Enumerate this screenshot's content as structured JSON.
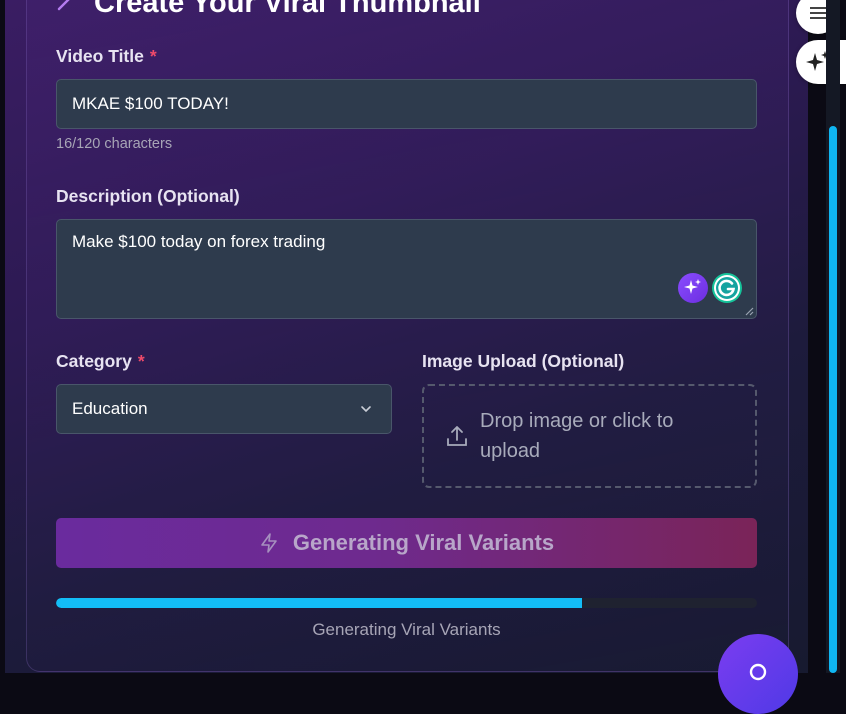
{
  "form": {
    "heading": "Create Your Viral Thumbnail",
    "title": {
      "label": "Video Title",
      "required": "*",
      "value": "MKAE $100 TODAY!",
      "counter": "16/120 characters"
    },
    "description": {
      "label": "Description (Optional)",
      "value": "Make $100 today on forex trading"
    },
    "category": {
      "label": "Category",
      "required": "*",
      "value": "Education"
    },
    "upload": {
      "label": "Image Upload (Optional)",
      "prompt": "Drop image or click to upload"
    },
    "generate_button": "Generating Viral Variants",
    "progress": {
      "percent": 75,
      "label": "Generating Viral Variants"
    }
  },
  "icons": {
    "heading": "magic-wand-icon",
    "upload": "upload-icon",
    "generate": "lightning-icon",
    "chevron": "chevron-down-icon",
    "ai_assist": "sparkles-icon",
    "grammarly": "grammarly-icon",
    "side_menu": "list-icon",
    "side_ai": "sparkles-icon",
    "fab": "search-icon"
  },
  "colors": {
    "accent": "#13bdf7",
    "required": "#ef4a6a",
    "input_bg": "#2e3b4d"
  }
}
